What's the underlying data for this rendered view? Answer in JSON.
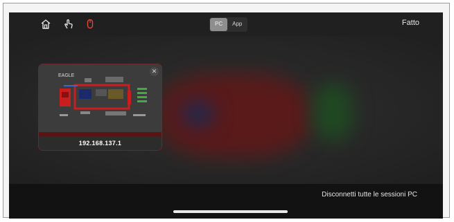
{
  "topbar": {
    "home_icon": "home-icon",
    "touch_icon": "hand-touch-icon",
    "mouse_icon": "mouse-icon",
    "mouse_icon_color": "#e0463a",
    "segments": [
      {
        "label": "PC",
        "active": true
      },
      {
        "label": "App",
        "active": false
      }
    ],
    "done_label": "Fatto"
  },
  "session": {
    "thumbnail_title": "EAGLE",
    "ip": "192.168.137.1",
    "close_icon": "close-icon",
    "accent": "#c81e1e"
  },
  "bottom": {
    "disconnect_label": "Disconnetti tutte le sessioni PC"
  }
}
